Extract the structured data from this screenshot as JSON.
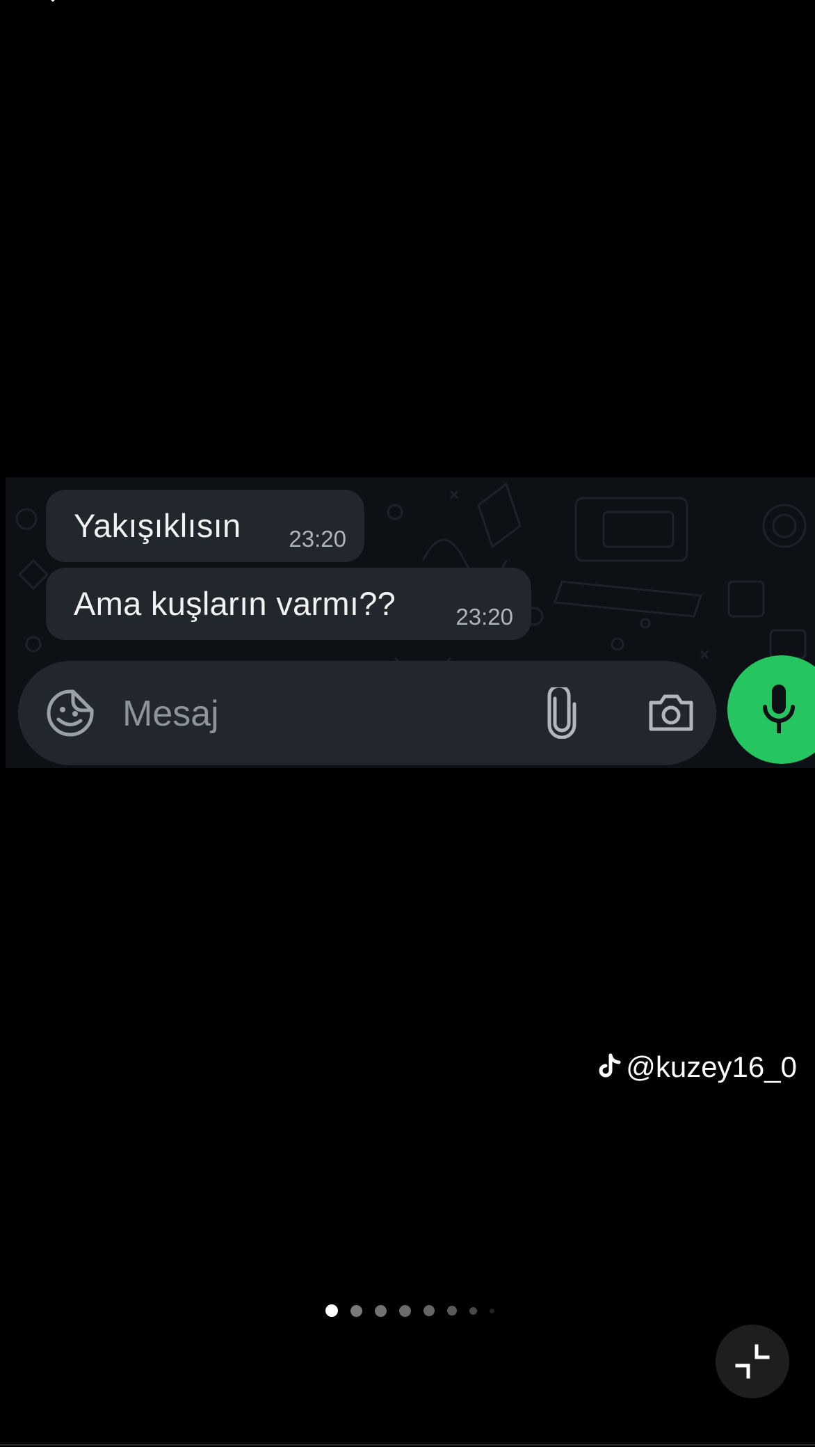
{
  "chat": {
    "messages": [
      {
        "text": "Yakışıklısın",
        "time": "23:20"
      },
      {
        "text": "Ama kuşların varmı??",
        "time": "23:20"
      }
    ],
    "input_placeholder": "Mesaj"
  },
  "icons": {
    "emoji": "sticker-emoji-icon",
    "attach": "paperclip-icon",
    "camera": "camera-icon",
    "mic": "microphone-icon",
    "watermark_logo": "tiktok-icon",
    "exit_fullscreen": "exit-fullscreen-icon"
  },
  "watermark": {
    "handle": "@kuzey16_0"
  },
  "pager": {
    "total_dots": 8,
    "active_index": 0
  },
  "colors": {
    "background": "#000000",
    "chat_background": "#0d1115",
    "bubble": "#22272d",
    "mic_button": "#25c660",
    "timestamp": "#aeb6bd",
    "placeholder": "#8d959c"
  }
}
